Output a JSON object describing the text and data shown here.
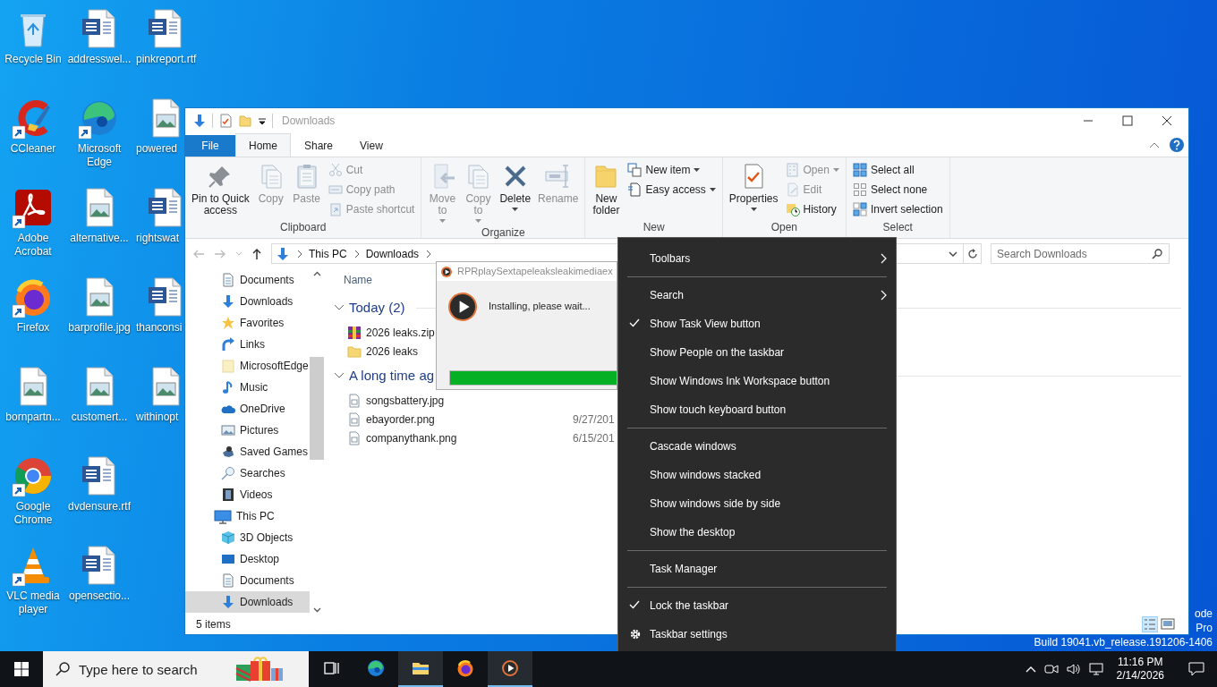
{
  "desktop": {
    "columns": [
      [
        {
          "label": "Recycle Bin",
          "kind": "recycle",
          "shortcut": false
        },
        {
          "label": "CCleaner",
          "kind": "ccleaner",
          "shortcut": true
        },
        {
          "label": "Adobe Acrobat",
          "kind": "acrobat",
          "shortcut": true
        },
        {
          "label": "Firefox",
          "kind": "firefox",
          "shortcut": true
        },
        {
          "label": "bornpartn...",
          "kind": "image",
          "shortcut": false
        },
        {
          "label": "Google Chrome",
          "kind": "chrome",
          "shortcut": true
        },
        {
          "label": "VLC media player",
          "kind": "vlc",
          "shortcut": true
        }
      ],
      [
        {
          "label": "addresswel...",
          "kind": "word",
          "shortcut": false
        },
        {
          "label": "Microsoft Edge",
          "kind": "edge",
          "shortcut": true
        },
        {
          "label": "alternative...",
          "kind": "image",
          "shortcut": false
        },
        {
          "label": "barprofile.jpg",
          "kind": "image",
          "shortcut": false
        },
        {
          "label": "customert...",
          "kind": "image",
          "shortcut": false
        },
        {
          "label": "dvdensure.rtf",
          "kind": "word",
          "shortcut": false
        },
        {
          "label": "opensectio...",
          "kind": "word",
          "shortcut": false
        }
      ],
      [
        {
          "label": "pinkreport.rtf",
          "kind": "word",
          "shortcut": false
        },
        {
          "label": "powered",
          "kind": "image",
          "shortcut": false
        },
        {
          "label": "rightswat",
          "kind": "word",
          "shortcut": false
        },
        {
          "label": "thanconsi",
          "kind": "word",
          "shortcut": false
        },
        {
          "label": "withinopt",
          "kind": "image",
          "shortcut": false
        }
      ]
    ],
    "os_info": [
      "ode",
      "Pro",
      "Build 19041.vb_release.191206-1406"
    ]
  },
  "explorer": {
    "title": "Downloads",
    "tabs": [
      {
        "label": "File",
        "kind": "menu",
        "selected": false
      },
      {
        "label": "Home",
        "kind": "tab",
        "selected": true
      },
      {
        "label": "Share",
        "kind": "tab",
        "selected": false
      },
      {
        "label": "View",
        "kind": "tab",
        "selected": false
      }
    ],
    "ribbon": [
      {
        "label": "Clipboard",
        "items": [
          {
            "label": "Pin to Quick\naccess",
            "kind": "large",
            "disabled": false,
            "dropdown": false
          },
          {
            "label": "Copy",
            "kind": "large",
            "disabled": true,
            "dropdown": false
          },
          {
            "label": "Paste",
            "kind": "large",
            "disabled": true,
            "dropdown": false
          },
          {
            "label": "Cut",
            "kind": "small",
            "disabled": true,
            "dropdown": false
          },
          {
            "label": "Copy path",
            "kind": "small",
            "disabled": true,
            "dropdown": false
          },
          {
            "label": "Paste shortcut",
            "kind": "small",
            "disabled": true,
            "dropdown": false
          }
        ]
      },
      {
        "label": "Organize",
        "items": [
          {
            "label": "Move\nto",
            "kind": "large",
            "disabled": true,
            "dropdown": true
          },
          {
            "label": "Copy\nto",
            "kind": "large",
            "disabled": true,
            "dropdown": true
          },
          {
            "label": "Delete",
            "kind": "large",
            "disabled": false,
            "dropdown": true
          },
          {
            "label": "Rename",
            "kind": "large",
            "disabled": true,
            "dropdown": false
          }
        ]
      },
      {
        "label": "New",
        "items": [
          {
            "label": "New\nfolder",
            "kind": "large",
            "disabled": false,
            "dropdown": false
          },
          {
            "label": "New item",
            "kind": "small",
            "disabled": false,
            "dropdown": true
          },
          {
            "label": "Easy access",
            "kind": "small",
            "disabled": false,
            "dropdown": true
          }
        ]
      },
      {
        "label": "Open",
        "items": [
          {
            "label": "Properties",
            "kind": "large",
            "disabled": false,
            "dropdown": true
          },
          {
            "label": "Open",
            "kind": "small",
            "disabled": true,
            "dropdown": true
          },
          {
            "label": "Edit",
            "kind": "small",
            "disabled": true,
            "dropdown": false
          },
          {
            "label": "History",
            "kind": "small",
            "disabled": false,
            "dropdown": false
          }
        ]
      },
      {
        "label": "Select",
        "items": [
          {
            "label": "Select all",
            "kind": "small",
            "disabled": false,
            "dropdown": false
          },
          {
            "label": "Select none",
            "kind": "small",
            "disabled": false,
            "dropdown": false
          },
          {
            "label": "Invert selection",
            "kind": "small",
            "disabled": false,
            "dropdown": false
          }
        ]
      }
    ],
    "address": {
      "crumbs": [
        "This PC",
        "Downloads"
      ]
    },
    "search": {
      "placeholder": "Search Downloads"
    },
    "nav": [
      {
        "label": "Documents",
        "selected": false
      },
      {
        "label": "Downloads",
        "selected": false
      },
      {
        "label": "Favorites",
        "selected": false
      },
      {
        "label": "Links",
        "selected": false
      },
      {
        "label": "MicrosoftEdge",
        "selected": false
      },
      {
        "label": "Music",
        "selected": false
      },
      {
        "label": "OneDrive",
        "selected": false
      },
      {
        "label": "Pictures",
        "selected": false
      },
      {
        "label": "Saved Games",
        "selected": false
      },
      {
        "label": "Searches",
        "selected": false
      },
      {
        "label": "Videos",
        "selected": false
      },
      {
        "label": "This PC",
        "selected": false,
        "children": [
          {
            "label": "3D Objects",
            "selected": false
          },
          {
            "label": "Desktop",
            "selected": false
          },
          {
            "label": "Documents",
            "selected": false
          },
          {
            "label": "Downloads",
            "selected": true
          }
        ]
      }
    ],
    "columns": [
      "Name"
    ],
    "groups": [
      {
        "label": "Today (2)",
        "expanded": true,
        "files": [
          {
            "name": "2026 leaks.zip",
            "kind": "archive"
          },
          {
            "name": "2026 leaks",
            "kind": "folder"
          }
        ]
      },
      {
        "label": "A long time ag",
        "expanded": true,
        "files": [
          {
            "name": "songsbattery.jpg",
            "kind": "image"
          },
          {
            "name": "ebayorder.png",
            "kind": "image",
            "date": "9/27/201"
          },
          {
            "name": "companythank.png",
            "kind": "image",
            "date": "6/15/201"
          }
        ]
      }
    ],
    "status": "5 items"
  },
  "installer": {
    "title": "RPRplaySextapeleaksleakimediaex",
    "message": "Installing, please wait...",
    "progress": {
      "level": 1
    }
  },
  "context_menu": {
    "items": [
      {
        "kind": "item",
        "label": "Toolbars",
        "checked": false,
        "submenu": true
      },
      {
        "kind": "separator"
      },
      {
        "kind": "item",
        "label": "Search",
        "checked": false,
        "submenu": true
      },
      {
        "kind": "item",
        "label": "Show Task View button",
        "checked": true,
        "submenu": false
      },
      {
        "kind": "item",
        "label": "Show People on the taskbar",
        "checked": false,
        "submenu": false
      },
      {
        "kind": "item",
        "label": "Show Windows Ink Workspace button",
        "checked": false,
        "submenu": false
      },
      {
        "kind": "item",
        "label": "Show touch keyboard button",
        "checked": false,
        "submenu": false
      },
      {
        "kind": "separator"
      },
      {
        "kind": "item",
        "label": "Cascade windows",
        "checked": false,
        "submenu": false
      },
      {
        "kind": "item",
        "label": "Show windows stacked",
        "checked": false,
        "submenu": false
      },
      {
        "kind": "item",
        "label": "Show windows side by side",
        "checked": false,
        "submenu": false
      },
      {
        "kind": "item",
        "label": "Show the desktop",
        "checked": false,
        "submenu": false
      },
      {
        "kind": "separator"
      },
      {
        "kind": "item",
        "label": "Task Manager",
        "checked": false,
        "submenu": false
      },
      {
        "kind": "separator"
      },
      {
        "kind": "item",
        "label": "Lock the taskbar",
        "checked": true,
        "submenu": false
      },
      {
        "kind": "settings",
        "label": "Taskbar settings",
        "checked": false,
        "submenu": false
      }
    ]
  },
  "taskbar": {
    "search": {
      "placeholder": "Type here to search"
    },
    "apps": [
      {
        "kind": "task-view",
        "active": false
      },
      {
        "kind": "edge",
        "active": false
      },
      {
        "kind": "explorer",
        "active": true
      },
      {
        "kind": "firefox",
        "active": false
      },
      {
        "kind": "player",
        "active": true
      }
    ],
    "clock": {
      "time": "11:16 PM",
      "date": "2/14/2026"
    }
  }
}
